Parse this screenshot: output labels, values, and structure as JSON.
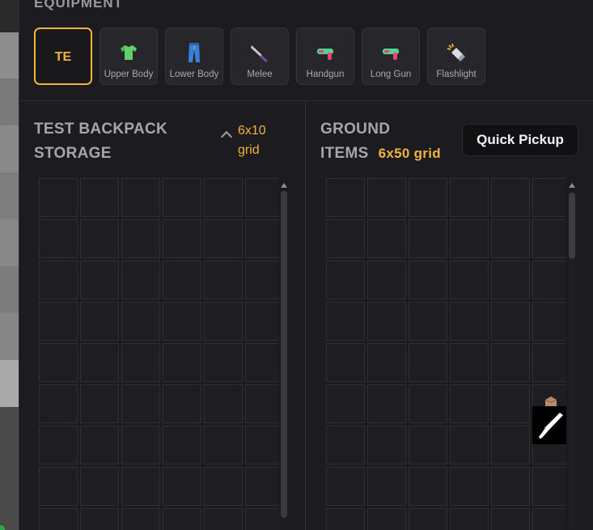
{
  "equipment": {
    "title": "EQUIPMENT",
    "active_slot": {
      "label": "TE"
    },
    "slots": [
      {
        "label": "Upper Body",
        "icon": "tshirt-icon"
      },
      {
        "label": "Lower Body",
        "icon": "jeans-icon"
      },
      {
        "label": "Melee",
        "icon": "knife-icon"
      },
      {
        "label": "Handgun",
        "icon": "water-pistol-icon"
      },
      {
        "label": "Long Gun",
        "icon": "water-pistol-icon"
      },
      {
        "label": "Flashlight",
        "icon": "flashlight-icon"
      }
    ]
  },
  "backpack": {
    "title_line1": "TEST BACKPACK",
    "title_line2": "STORAGE",
    "grid_line1": "6x10",
    "grid_line2": "grid",
    "collapse_icon": "chevron-up-icon"
  },
  "ground": {
    "title_line1": "GROUND",
    "title_line2": "ITEMS",
    "grid_size": "6x50 grid",
    "quick_pickup_label": "Quick Pickup",
    "items": [
      {
        "icon": "knife-icon"
      },
      {
        "icon": "box-icon"
      }
    ]
  },
  "colors": {
    "accent": "#f1b43a",
    "background": "#1c1c20",
    "cell": "#1e1e22",
    "cell_border": "#2f2f34"
  }
}
